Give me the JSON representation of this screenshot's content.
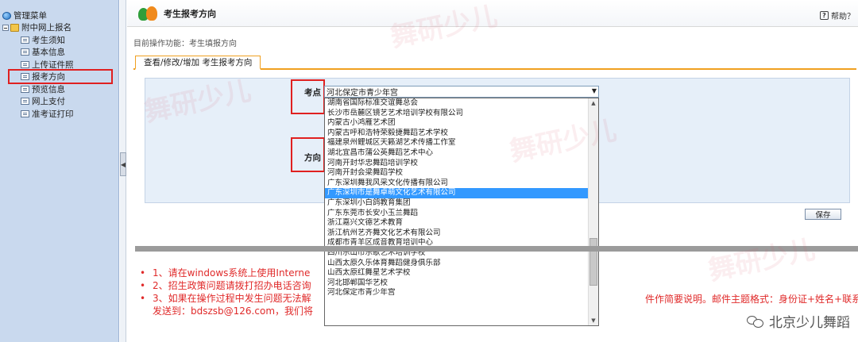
{
  "sidebar": {
    "root_label": "管理菜单",
    "group_label": "附中网上报名",
    "items": [
      {
        "label": "考生须知",
        "selected": false
      },
      {
        "label": "基本信息",
        "selected": false
      },
      {
        "label": "上传证件照",
        "selected": false
      },
      {
        "label": "报考方向",
        "selected": true
      },
      {
        "label": "预览信息",
        "selected": false
      },
      {
        "label": "网上支付",
        "selected": false
      },
      {
        "label": "准考证打印",
        "selected": false
      }
    ]
  },
  "header": {
    "title": "考生报考方向",
    "help_label": "帮助？"
  },
  "breadcrumb": "目前操作功能：考生填报方向",
  "tab_label": "查看/修改/增加 考生报考方向",
  "form": {
    "kaodian_label": "考点",
    "fangxiang_label": "方向",
    "selected_value": "河北保定市青少年宫",
    "options": [
      "湖南省国际标准交谊舞总会",
      "长沙市岳麓区镜艺艺术培训学校有限公司",
      "内蒙古小鸿雁艺术团",
      "内蒙古呼和浩特荣毅捷舞蹈艺术学校",
      "福建泉州鲤城区天籁湖艺术传播工作室",
      "湖北宜昌市蒲公英舞蹈艺术中心",
      "河南开封华忠舞蹈培训学校",
      "河南开封会梁舞蹈学校",
      "广东深圳舞我风采文化传播有限公司",
      "广东深圳市是舞卓萌文化艺术有限公司",
      "广东深圳小白鸽教育集团",
      "广东东莞市长安小玉兰舞蹈",
      "浙江嘉兴文德艺术教育",
      "浙江杭州艺齐舞文化艺术有限公司",
      "成都市青羊区成音教育培训中心",
      "四川乐山市乐歌艺术培训学校",
      "山西太原久乐体育舞蹈健身俱乐部",
      "山西太原红舞星艺术学校",
      "河北邯郸国华艺校",
      "河北保定市青少年宫"
    ],
    "highlighted_index": 9,
    "save_label": "保存"
  },
  "notes": [
    "1、请在windows系统上使用Interne",
    "2、招生政策问题请拨打招办电话咨询",
    "3、如果在操作过程中发生问题无法解",
    "发送到：bdszsb@126.com，我们将"
  ],
  "note_tail": "件作简要说明。邮件主题格式：身份证+姓名+联系电话。",
  "watermark": {
    "brand": "北京少儿舞蹈",
    "mark": "舞研少儿"
  },
  "colors": {
    "sidebar_bg": "#c9d9ee",
    "highlight": "#3399ff",
    "accent_tab": "#f0a020",
    "annotation_red": "#e02020",
    "note_red": "#e02a2a"
  }
}
